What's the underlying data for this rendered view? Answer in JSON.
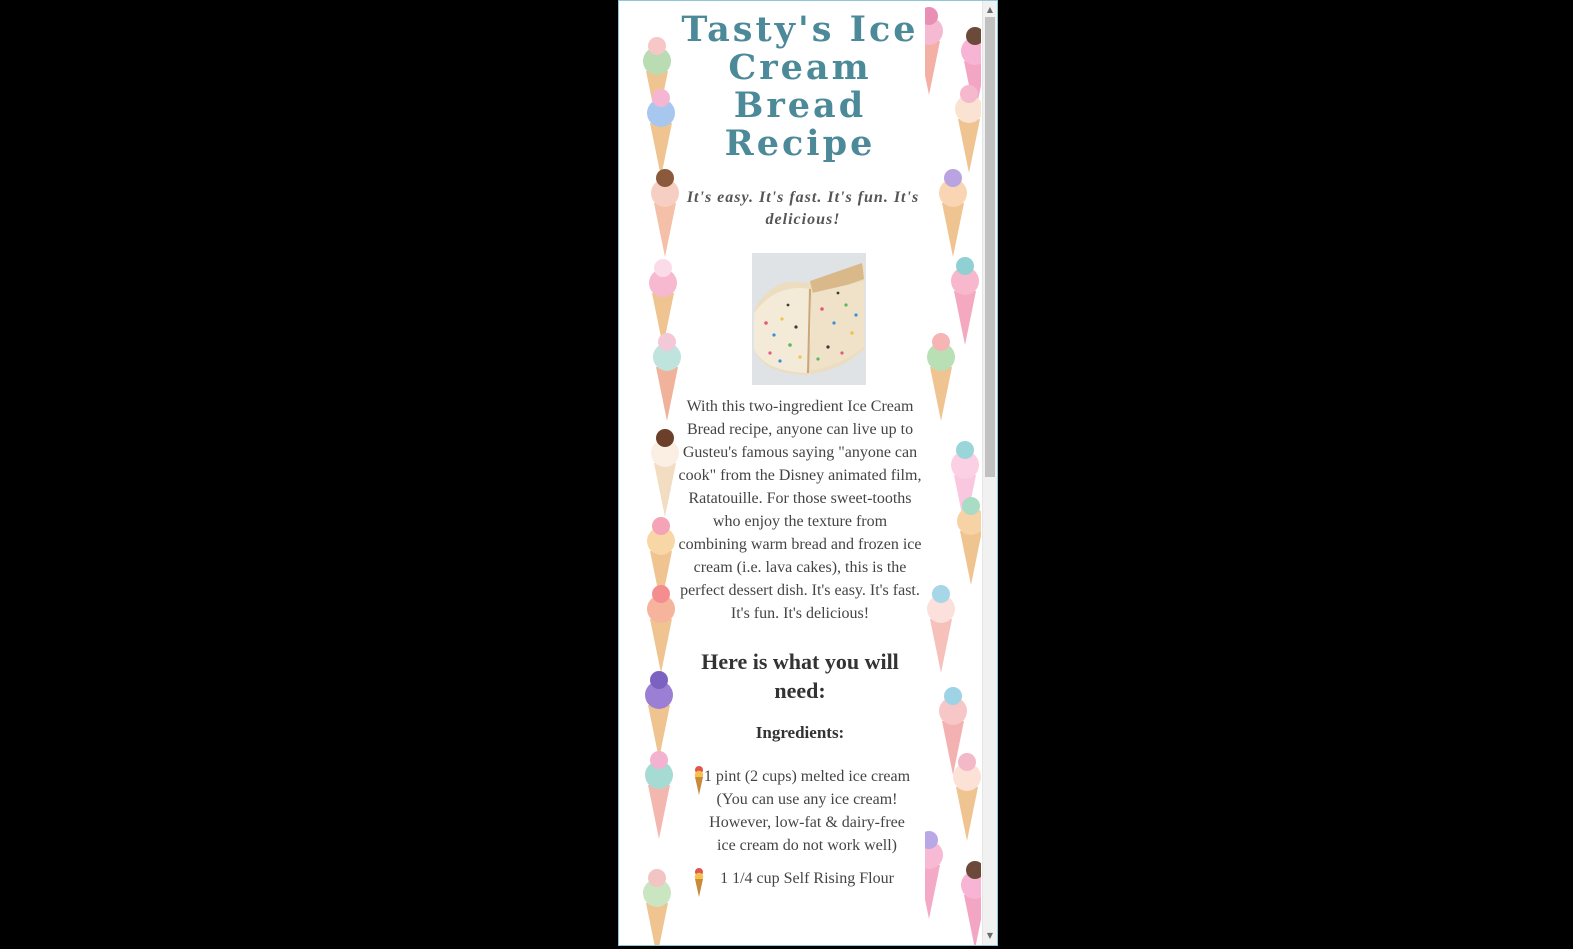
{
  "page": {
    "title": "Tasty's Ice Cream Bread Recipe",
    "tagline": "It's easy. It's fast. It's fun. It's delicious!",
    "photo_icon": "ice-cream-bread-photo",
    "intro": "With this two-ingredient Ice Cream Bread recipe, anyone can live up to Gusteu's famous saying \"anyone can cook\" from the Disney animated film, Ratatouille. For those sweet-tooths who enjoy the texture from combining warm bread and frozen ice cream (i.e. lava cakes), this is the perfect dessert dish. It's easy. It's fast. It's fun. It's delicious!",
    "need_heading": "Here is what you will need:",
    "ingredients_heading": "Ingredients:",
    "ingredients": [
      "1 pint (2 cups) melted ice cream (You can use any ice cream! However, low-fat & dairy-free ice cream do not work well)",
      "1 1/4 cup Self Rising Flour"
    ],
    "bullet_icon": "ice-cream-cone-icon"
  },
  "colors": {
    "title": "#4d8a99",
    "background": "#ffffff",
    "outer": "#000000"
  },
  "scrollbar": {
    "up_arrow": "▲",
    "down_arrow": "▼"
  }
}
